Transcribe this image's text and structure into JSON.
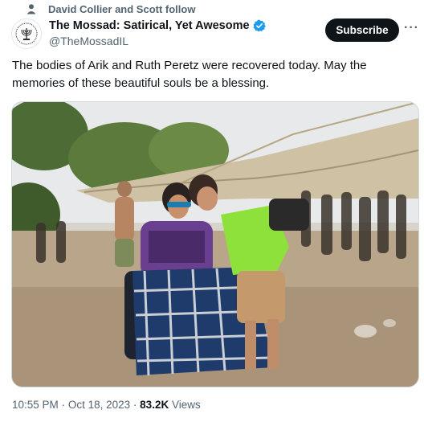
{
  "social_context": {
    "text": "David Collier and Scott follow",
    "icon": "person-icon"
  },
  "author": {
    "display_name": "The Mossad: Satirical, Yet Awesome",
    "handle": "@TheMossadIL",
    "verified_color": "#1d9bf0"
  },
  "actions": {
    "subscribe_label": "Subscribe",
    "more_icon": "more-icon"
  },
  "tweet": {
    "text": "The bodies of Arik and Ruth Peretz were recovered today. May the memories of these beautiful souls be a blessing."
  },
  "meta": {
    "time": "10:55 PM",
    "separator": "·",
    "date": "Oct 18, 2023",
    "views_count": "83.2K",
    "views_label": "Views"
  }
}
